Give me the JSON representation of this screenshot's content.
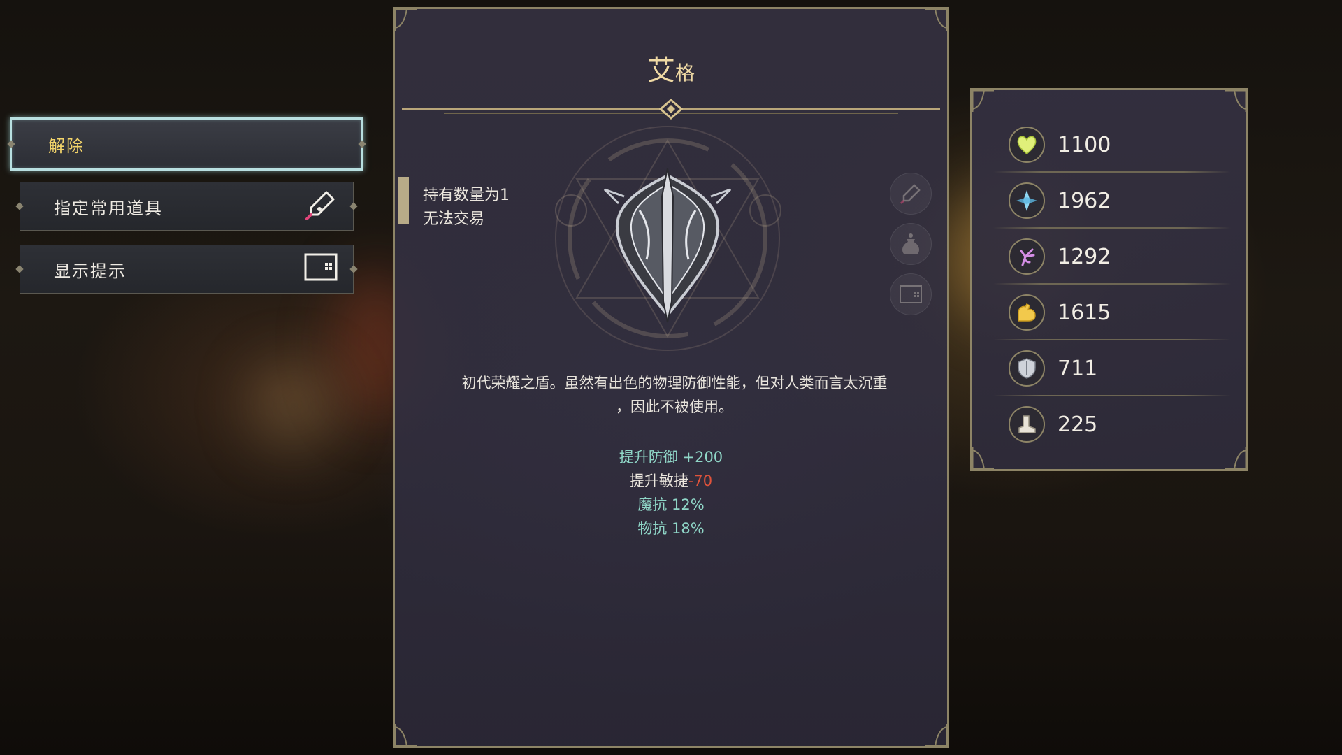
{
  "menu": {
    "items": [
      {
        "label": "解除",
        "selected": true,
        "icon": null
      },
      {
        "label": "指定常用道具",
        "selected": false,
        "icon": "pen-icon"
      },
      {
        "label": "显示提示",
        "selected": false,
        "icon": "hint-box-icon"
      }
    ]
  },
  "item": {
    "title_big": "艾",
    "title_small": "格",
    "info": [
      "持有数量为1",
      "无法交易"
    ],
    "description_line1": "初代荣耀之盾。虽然有出色的物理防御性能，但对人类而言太沉重",
    "description_line2": "，因此不被使用。",
    "stats": [
      {
        "text": "提升防御 +200",
        "color": "#8fd6c7"
      },
      {
        "text_a": "提升敏捷",
        "text_b": "-70",
        "color_a": "#ece7de",
        "color_b": "#e0533b"
      },
      {
        "text": "魔抗 12%",
        "color": "#8fd6c7"
      },
      {
        "text": "物抗 18%",
        "color": "#8fd6c7"
      }
    ],
    "side_icons": [
      "pen-icon",
      "pouch-icon",
      "hint-box-icon"
    ]
  },
  "attributes": [
    {
      "icon": "heart-icon",
      "value": "1100"
    },
    {
      "icon": "crystal-icon",
      "value": "1962"
    },
    {
      "icon": "magic-hand-icon",
      "value": "1292"
    },
    {
      "icon": "muscle-icon",
      "value": "1615"
    },
    {
      "icon": "shield-icon",
      "value": "711"
    },
    {
      "icon": "boot-icon",
      "value": "225"
    }
  ]
}
